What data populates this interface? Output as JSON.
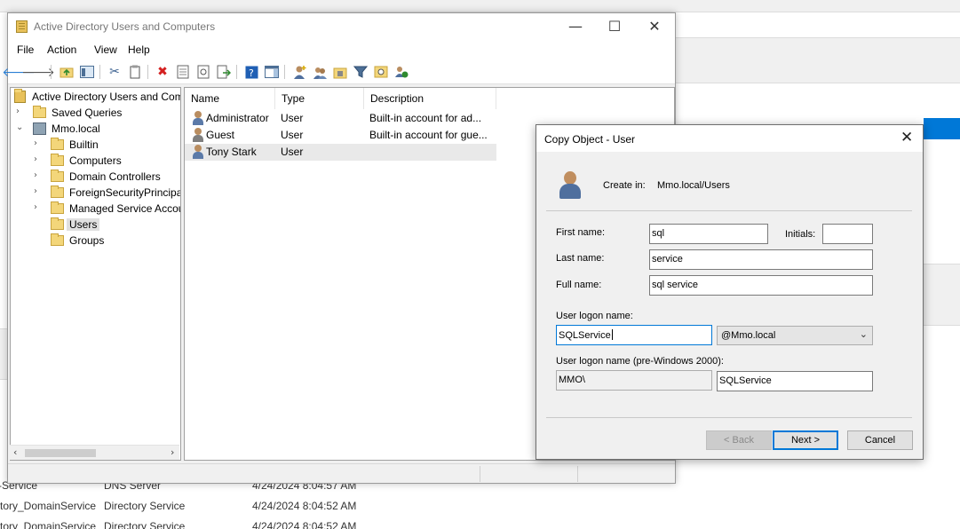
{
  "background": {
    "rows": [
      {
        "name": "r-Service",
        "type": "DNS Server",
        "date": "4/24/2024 8:04:57 AM"
      },
      {
        "name": "ctory_DomainService",
        "type": "Directory Service",
        "date": "4/24/2024 8:04:52 AM"
      },
      {
        "name": "ctory_DomainService",
        "type": "Directory Service",
        "date": "4/24/2024 8:04:52 AM"
      }
    ]
  },
  "window": {
    "title": "Active Directory Users and Computers",
    "minimize": "—",
    "maximize": "☐",
    "close": "✕"
  },
  "menu": [
    "File",
    "Action",
    "View",
    "Help"
  ],
  "toolbar": {
    "icons": [
      "back-arrow-icon",
      "forward-arrow-icon",
      "up-folder-icon",
      "show-console-tree-icon",
      "cut-icon",
      "copy-icon",
      "delete-icon",
      "properties-icon",
      "refresh-icon",
      "export-list-icon",
      "help-icon",
      "action-pane-icon",
      "new-user-icon",
      "new-group-icon",
      "new-ou-icon",
      "filter-icon",
      "find-icon",
      "add-to-group-icon"
    ]
  },
  "tree": {
    "root": "Active Directory Users and Computers",
    "nodes": [
      {
        "label": "Saved Queries"
      },
      {
        "label": "Mmo.local"
      },
      {
        "label": "Builtin"
      },
      {
        "label": "Computers"
      },
      {
        "label": "Domain Controllers"
      },
      {
        "label": "ForeignSecurityPrincipals"
      },
      {
        "label": "Managed Service Accounts"
      },
      {
        "label": "Users"
      },
      {
        "label": "Groups"
      }
    ]
  },
  "list": {
    "columns": [
      "Name",
      "Type",
      "Description"
    ],
    "rows": [
      {
        "name": "Administrator",
        "type": "User",
        "description": "Built-in account for ad..."
      },
      {
        "name": "Guest",
        "type": "User",
        "description": "Built-in account for gue..."
      },
      {
        "name": "Tony Stark",
        "type": "User",
        "description": ""
      }
    ]
  },
  "dialog": {
    "title": "Copy Object - User",
    "create_in_label": "Create in:",
    "create_in_value": "Mmo.local/Users",
    "first_name_label": "First name:",
    "first_name": "sql",
    "initials_label": "Initials:",
    "initials": "",
    "last_name_label": "Last name:",
    "last_name": "service",
    "full_name_label": "Full name:",
    "full_name": "sql service",
    "logon_label": "User logon name:",
    "logon_name": "SQLService",
    "domain_suffix": "@Mmo.local",
    "pre2000_label": "User logon name (pre-Windows 2000):",
    "pre2000_domain": "MMO\\",
    "pre2000_name": "SQLService",
    "back_button": "< Back",
    "next_button": "Next >",
    "cancel_button": "Cancel"
  }
}
